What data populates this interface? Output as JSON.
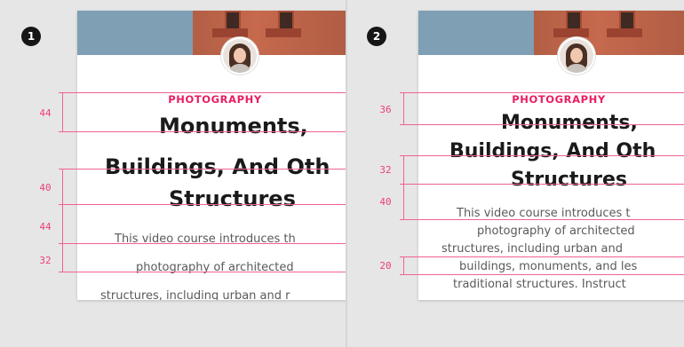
{
  "panels": [
    {
      "badge": "1",
      "card": {
        "category": "PHOTOGRAPHY",
        "title_lines": [
          "Monuments,",
          "Buildings, And Oth",
          "Structures"
        ],
        "body_lines": [
          "This video course introduces th",
          "photography of architected",
          "structures, including urban and r"
        ]
      },
      "spacing_labels": [
        "44",
        "40",
        "44",
        "32"
      ]
    },
    {
      "badge": "2",
      "card": {
        "category": "PHOTOGRAPHY",
        "title_lines": [
          "Monuments,",
          "Buildings, And Oth",
          "Structures"
        ],
        "body_lines": [
          "This video course introduces t",
          "photography of architected",
          "structures, including urban and",
          "buildings, monuments, and les",
          "traditional structures. Instruct"
        ]
      },
      "spacing_labels": [
        "36",
        "32",
        "40",
        "20"
      ]
    }
  ],
  "colors": {
    "accent": "#e91e63",
    "guide": "#f06292",
    "background": "#e6e6e6",
    "card": "#ffffff"
  },
  "icons": [
    "step-number-badge",
    "avatar-photo",
    "hero-photo"
  ]
}
